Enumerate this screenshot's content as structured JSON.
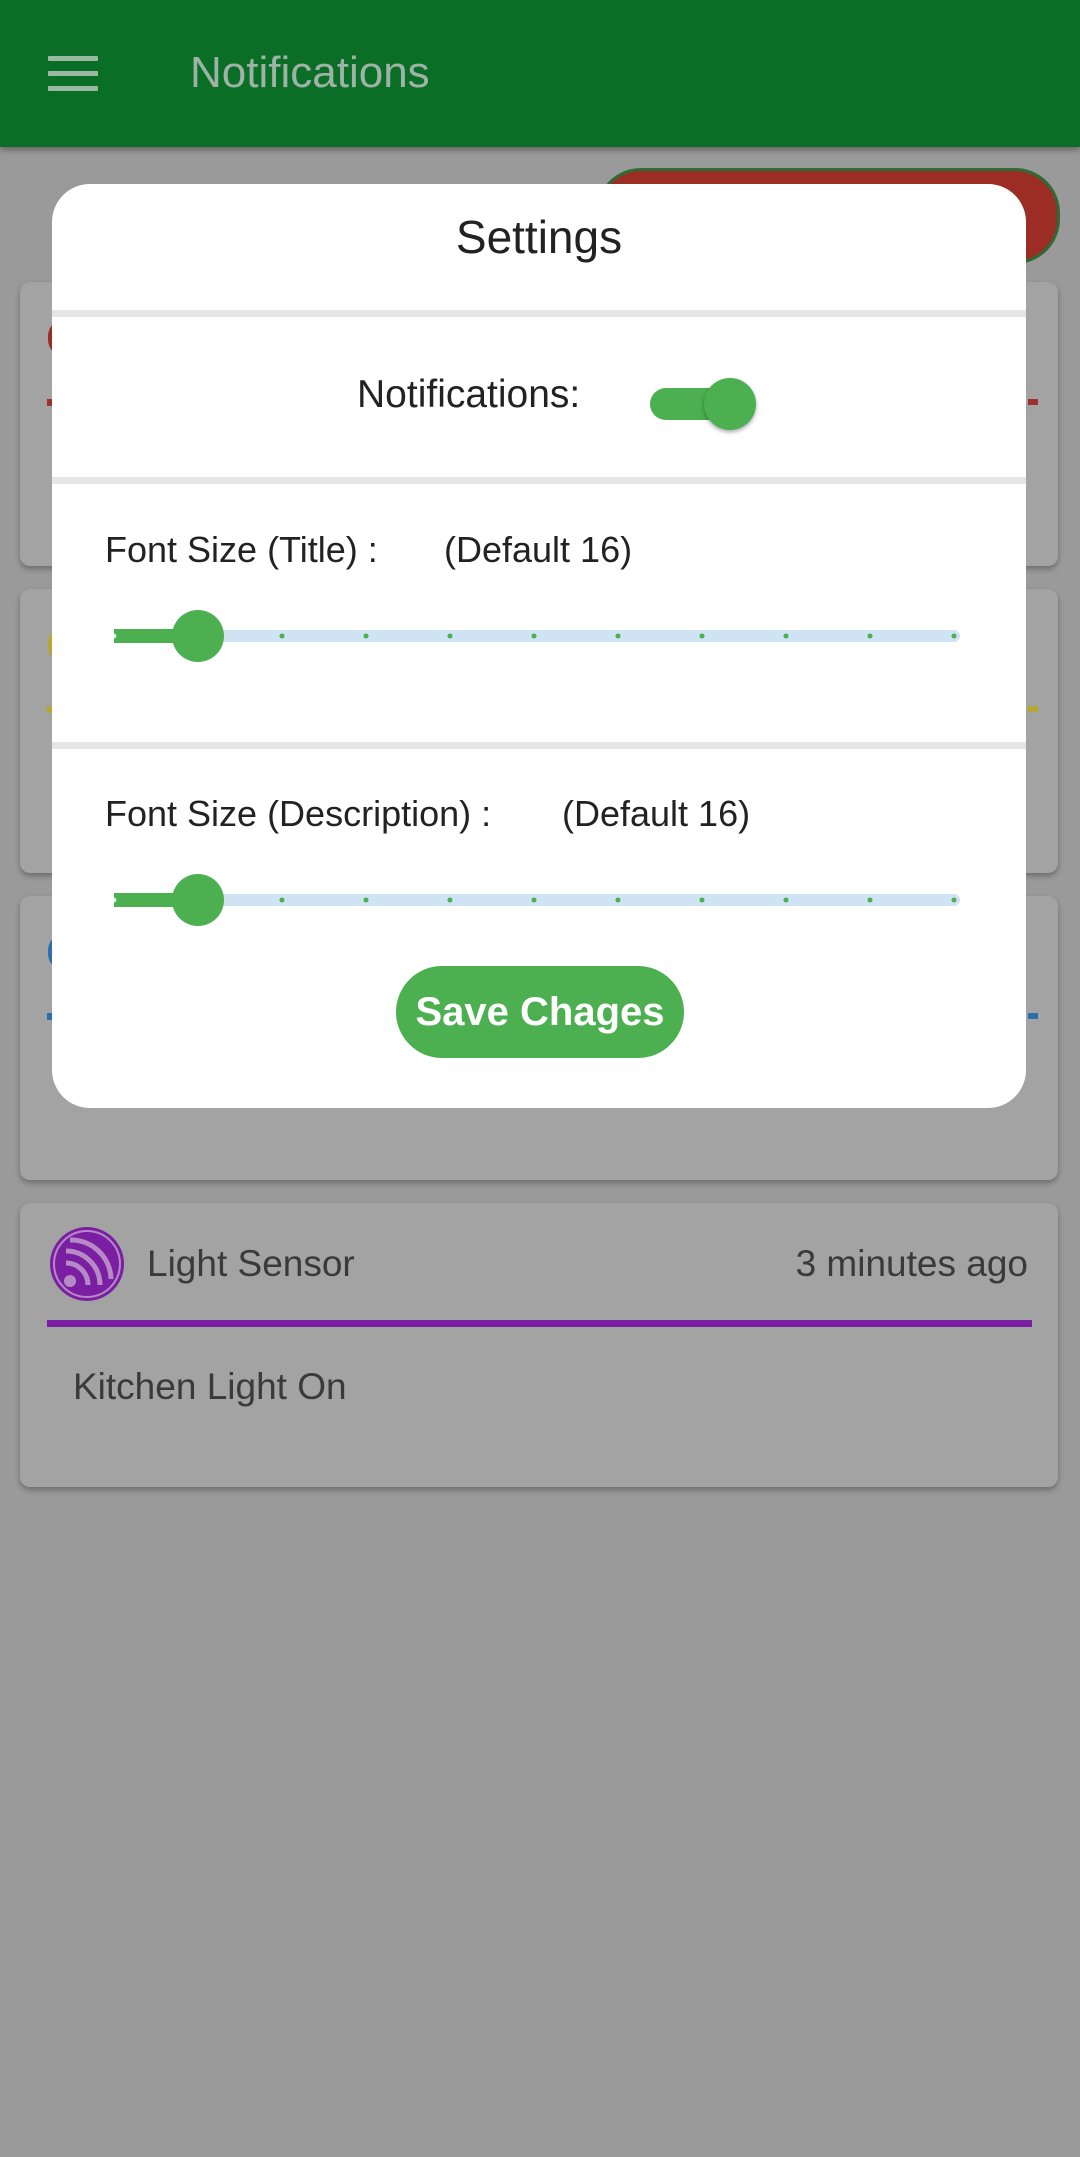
{
  "appbar": {
    "title": "Notifications",
    "menu_icon": "hamburger-menu-icon"
  },
  "background_cards": [
    {
      "source": "Light Sensor",
      "time": "3 minutes ago",
      "message": "Kitchen Light On",
      "accent": "#7b1fa2"
    }
  ],
  "settings": {
    "title": "Settings",
    "notifications_label": "Notifications:",
    "notifications_enabled": true,
    "font_title": {
      "label": "Font Size (Title) :",
      "default_text": "(Default 16)",
      "level_fraction": 0.1,
      "steps": 10
    },
    "font_description": {
      "label": "Font Size (Description) :",
      "default_text": "(Default 16)",
      "level_fraction": 0.1,
      "steps": 10
    },
    "save_label": "Save Chages"
  },
  "colors": {
    "appbar": "#0b6e27",
    "accent": "#4caf50",
    "slider_track": "#cfe3f5"
  }
}
